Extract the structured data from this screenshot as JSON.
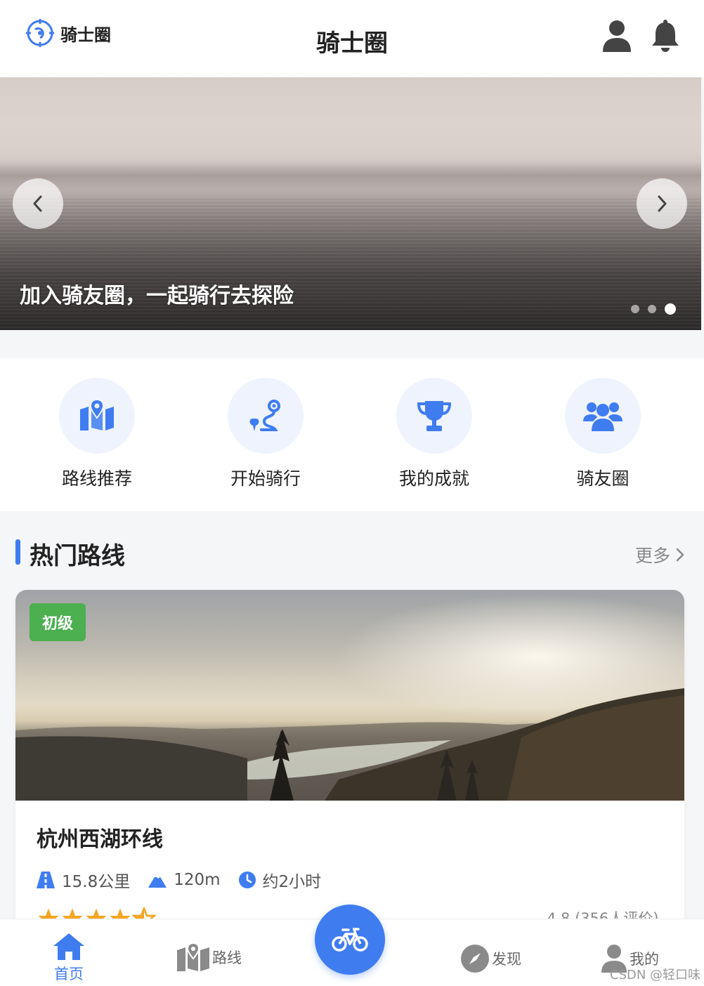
{
  "header": {
    "logo_text": "骑士圈",
    "title": "骑士圈"
  },
  "banner": {
    "caption": "加入骑友圈，一起骑行去探险",
    "slide_count": 3,
    "active_slide": 3
  },
  "quick_menu": [
    {
      "label": "路线推荐",
      "icon": "map-marker-icon"
    },
    {
      "label": "开始骑行",
      "icon": "route-icon"
    },
    {
      "label": "我的成就",
      "icon": "trophy-icon"
    },
    {
      "label": "骑友圈",
      "icon": "users-icon"
    }
  ],
  "hot_routes": {
    "title": "热门路线",
    "more_label": "更多",
    "cards": [
      {
        "level": "初级",
        "name": "杭州西湖环线",
        "distance": "15.8公里",
        "elevation": "120m",
        "duration": "约2小时",
        "stars": 4.5,
        "rating_text": "4.8 (356人评价)"
      }
    ]
  },
  "bottom_nav": {
    "home": "首页",
    "routes": "路线",
    "discover": "发现",
    "mine": "我的",
    "active": "home"
  },
  "watermark": "CSDN @轻口味",
  "colors": {
    "accent": "#3f7cf0",
    "level_beginner": "#4caf50",
    "star": "#f5a623"
  }
}
